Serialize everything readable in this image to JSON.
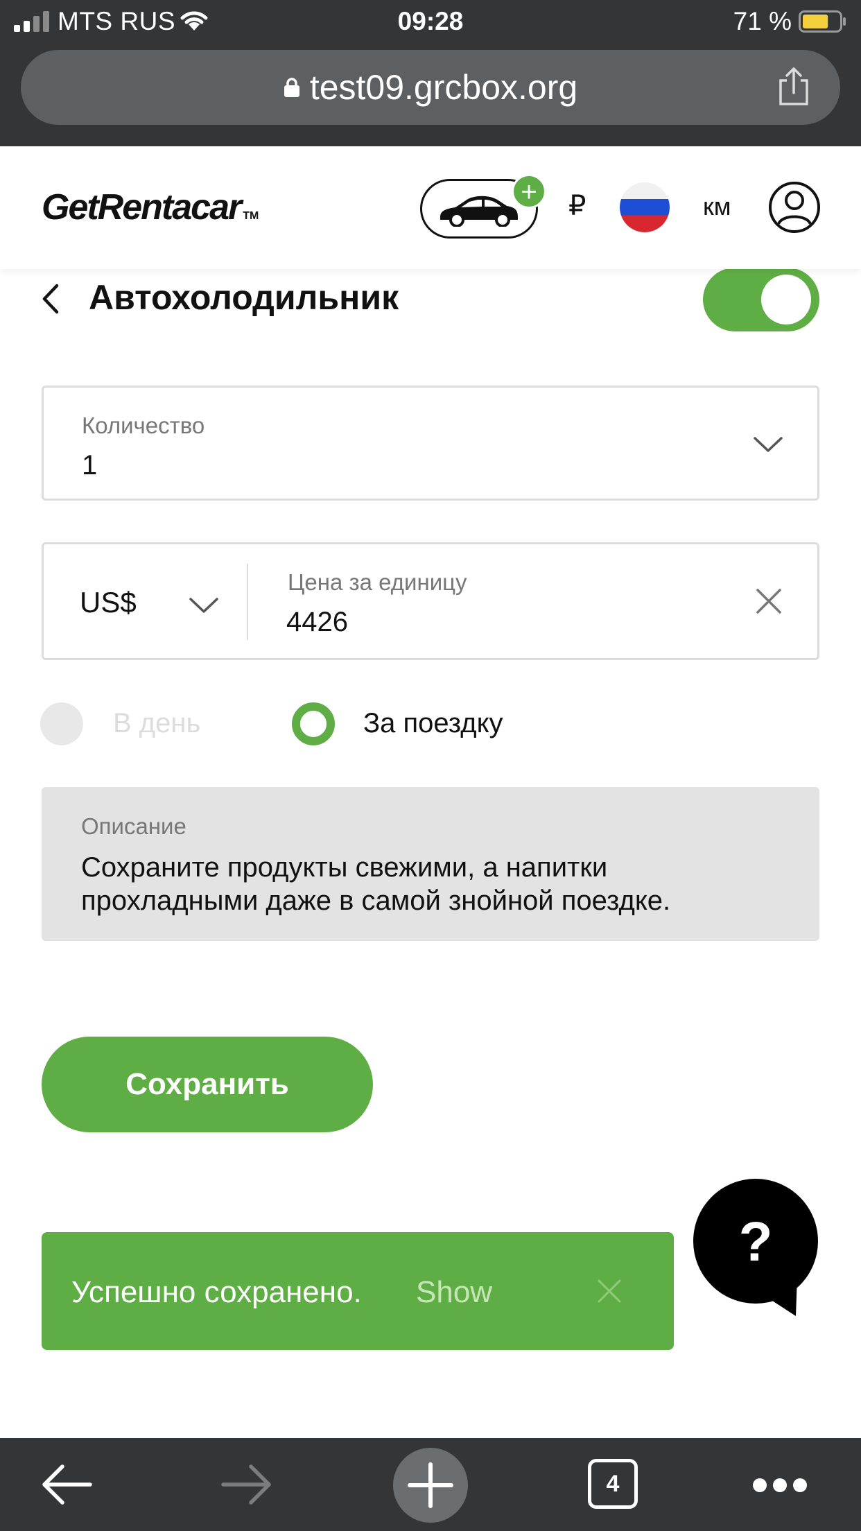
{
  "status_bar": {
    "carrier": "MTS RUS",
    "time": "09:28",
    "battery_percent": "71 %",
    "battery_level": 0.71
  },
  "browser": {
    "url": "test09.grcbox.org",
    "tab_count": "4"
  },
  "header": {
    "logo": "GetRentacar",
    "logo_tm": "TM",
    "currency_symbol": "₽",
    "units": "км",
    "flag": "russia-flag"
  },
  "page": {
    "title": "Автохолодильник",
    "enabled": true
  },
  "form": {
    "quantity_label": "Количество",
    "quantity_value": "1",
    "currency": "US$",
    "price_label": "Цена за единицу",
    "price_value": "4426",
    "radio_per_day": "В день",
    "radio_per_trip": "За поездку",
    "selected_rate": "per_trip",
    "description_label": "Описание",
    "description_text": "Сохраните продукты свежими, а напитки прохладными даже в самой знойной поездке.",
    "save_label": "Сохранить"
  },
  "snackbar": {
    "message": "Успешно сохранено.",
    "action": "Show"
  },
  "help": {
    "symbol": "?"
  },
  "colors": {
    "accent_green": "#5fae45",
    "browser_chrome": "#333537"
  }
}
